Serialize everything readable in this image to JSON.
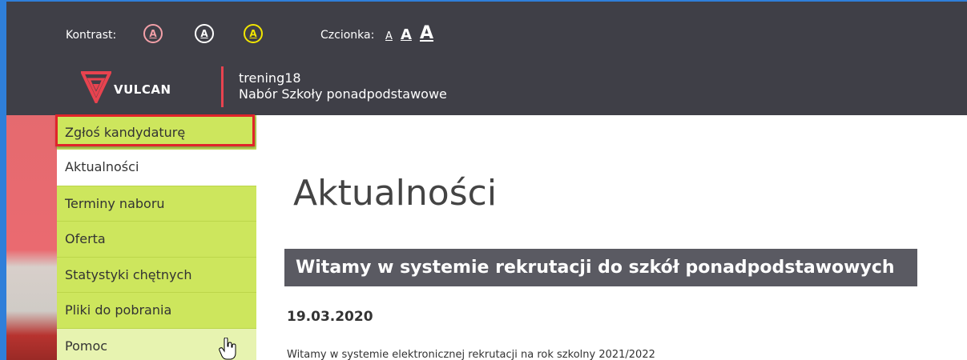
{
  "header": {
    "contrast_label": "Kontrast:",
    "contrast_buttons": [
      "A",
      "A",
      "A"
    ],
    "contrast_colors": [
      "#f3a0a8",
      "#ffffff",
      "#f2e600"
    ],
    "font_label": "Czcionka:",
    "font_buttons": [
      "A",
      "A",
      "A"
    ],
    "logo_text": "VULCAN",
    "logo_color": "#e8434f",
    "school_line1": "trening18",
    "school_line2": "Nabór Szkoły ponadpodstawowe",
    "bg_color": "#3f3f47"
  },
  "sidebar": {
    "accent": "#cde65d",
    "items": [
      {
        "label": "Zgłoś kandydaturę"
      },
      {
        "label": "Aktualności"
      },
      {
        "label": "Terminy naboru"
      },
      {
        "label": "Oferta"
      },
      {
        "label": "Statystyki chętnych"
      },
      {
        "label": "Pliki do pobrania"
      },
      {
        "label": "Pomoc"
      }
    ]
  },
  "main": {
    "title": "Aktualności",
    "news": {
      "headline": "Witamy w systemie rekrutacji do szkół ponadpodstawowych",
      "date": "19.03.2020",
      "body": "Witamy w systemie elektronicznej rekrutacji na rok szkolny 2021/2022"
    }
  }
}
